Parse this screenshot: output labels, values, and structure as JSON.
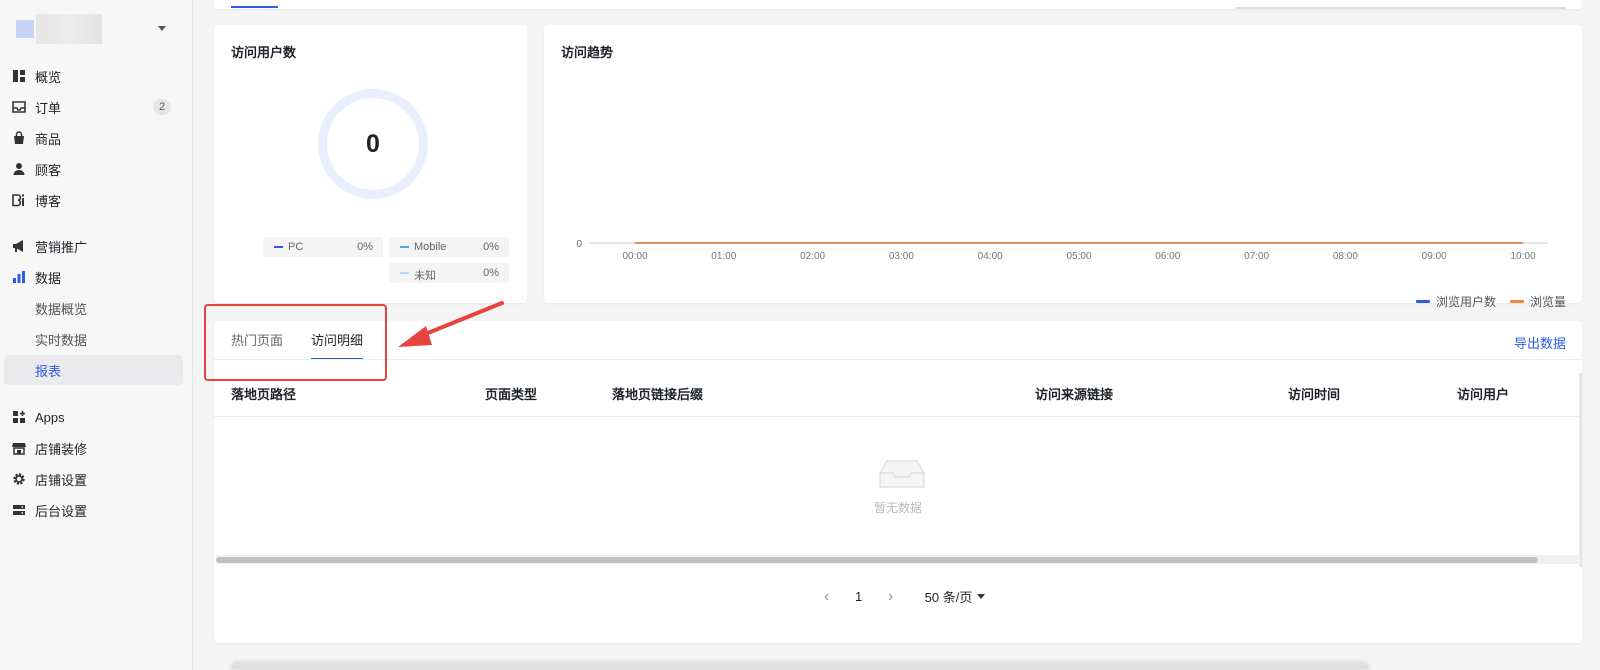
{
  "sidebar": {
    "nav": [
      {
        "label": "概览",
        "icon": "overview-icon"
      },
      {
        "label": "订单",
        "icon": "inbox-icon",
        "badge": "2"
      },
      {
        "label": "商品",
        "icon": "bag-icon"
      },
      {
        "label": "顾客",
        "icon": "user-icon"
      },
      {
        "label": "博客",
        "icon": "blog-icon"
      },
      {
        "label": "营销推广",
        "icon": "megaphone-icon"
      },
      {
        "label": "数据",
        "icon": "bar-chart-icon"
      }
    ],
    "data_sub": [
      {
        "label": "数据概览"
      },
      {
        "label": "实时数据"
      },
      {
        "label": "报表",
        "active": true
      }
    ],
    "nav_bottom": [
      {
        "label": "Apps",
        "icon": "apps-icon"
      },
      {
        "label": "店铺装修",
        "icon": "store-icon"
      },
      {
        "label": "店铺设置",
        "icon": "gear-icon"
      },
      {
        "label": "后台设置",
        "icon": "server-icon"
      }
    ]
  },
  "visitors_card": {
    "title": "访问用户数",
    "total": "0",
    "legend": [
      {
        "label": "PC",
        "pct": "0%",
        "color": "#2b5ce6"
      },
      {
        "label": "Mobile",
        "pct": "0%",
        "color": "#4aa3f0"
      },
      {
        "label": "未知",
        "pct": "0%",
        "color": "#b9d4f7"
      }
    ]
  },
  "trend_card": {
    "title": "访问趋势",
    "legend": [
      {
        "label": "浏览用户数",
        "color": "#2b5ce6"
      },
      {
        "label": "浏览量",
        "color": "#f5873a"
      }
    ]
  },
  "chart_data": {
    "type": "line",
    "title": "访问趋势",
    "x": [
      "00:00",
      "01:00",
      "02:00",
      "03:00",
      "04:00",
      "05:00",
      "06:00",
      "07:00",
      "08:00",
      "09:00",
      "10:00"
    ],
    "y_ticks": [
      "0"
    ],
    "series": [
      {
        "name": "浏览用户数",
        "values": [
          0,
          0,
          0,
          0,
          0,
          0,
          0,
          0,
          0,
          0,
          0
        ],
        "color": "#2b5ce6"
      },
      {
        "name": "浏览量",
        "values": [
          0,
          0,
          0,
          0,
          0,
          0,
          0,
          0,
          0,
          0,
          0
        ],
        "color": "#f5873a"
      }
    ],
    "legend": "bottom-right",
    "grid": false
  },
  "table_card": {
    "tabs": [
      {
        "label": "热门页面",
        "active": false
      },
      {
        "label": "访问明细",
        "active": true
      }
    ],
    "export_label": "导出数据",
    "columns": [
      "落地页路径",
      "页面类型",
      "落地页链接后缀",
      "访问来源链接",
      "访问时间",
      "访问用户"
    ],
    "rows": [],
    "empty_text": "暂无数据",
    "pager": {
      "current_page": "1",
      "page_size": "50 条/页"
    }
  }
}
